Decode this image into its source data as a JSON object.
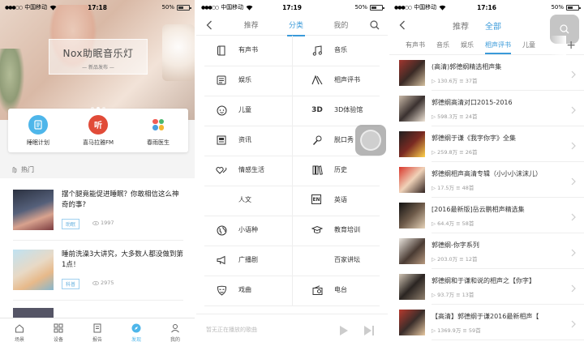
{
  "colors": {
    "accent": "#3a9ad9",
    "sleep_blue": "#4eb6ea",
    "xmly_red": "#e14b38"
  },
  "panel1": {
    "status": {
      "carrier": "中国移动",
      "time": "17:18",
      "battery": "50%"
    },
    "banner": {
      "title": "Nox助眠音乐灯",
      "subtitle": "— 新品发布 —"
    },
    "quick_links": [
      {
        "label": "睡眠计划",
        "icon": "sleep-plan-icon"
      },
      {
        "label": "喜马拉雅FM",
        "icon": "ximalaya-icon",
        "glyph": "听"
      },
      {
        "label": "春雨医生",
        "icon": "chunyu-icon"
      }
    ],
    "hot_label": "热门",
    "articles": [
      {
        "title": "摆个腿竟能促进睡眠？你敢相信这么神奇的事?",
        "tag": "助眠",
        "views": "1997"
      },
      {
        "title": "睡前洗澡3大讲究，大多数人都没做到第1点！",
        "tag": "科普",
        "views": "2975"
      }
    ],
    "tabs": [
      {
        "label": "场景",
        "icon": "home-icon"
      },
      {
        "label": "设备",
        "icon": "grid-icon"
      },
      {
        "label": "报告",
        "icon": "report-icon"
      },
      {
        "label": "发现",
        "icon": "discover-icon",
        "active": true
      },
      {
        "label": "我的",
        "icon": "user-icon"
      }
    ]
  },
  "panel2": {
    "status": {
      "carrier": "中国移动",
      "time": "17:19",
      "battery": "50%"
    },
    "tabs": [
      {
        "label": "推荐"
      },
      {
        "label": "分类",
        "active": true
      },
      {
        "label": "我的"
      }
    ],
    "categories": [
      {
        "label": "有声书",
        "icon": "book-icon"
      },
      {
        "label": "音乐",
        "icon": "music-note-icon"
      },
      {
        "label": "娱乐",
        "icon": "entertainment-icon"
      },
      {
        "label": "相声评书",
        "icon": "crosstalk-icon"
      },
      {
        "label": "儿童",
        "icon": "child-face-icon"
      },
      {
        "label": "3D体验馆",
        "icon": "3d-icon",
        "glyph": "3D"
      },
      {
        "label": "资讯",
        "icon": "news-icon"
      },
      {
        "label": "脱口秀",
        "icon": "microphone-icon"
      },
      {
        "label": "情感生活",
        "icon": "hearts-icon"
      },
      {
        "label": "历史",
        "icon": "books-icon"
      },
      {
        "label": "人文",
        "icon": ""
      },
      {
        "label": "英语",
        "icon": "english-icon",
        "glyph": "EN"
      },
      {
        "label": "小语种",
        "icon": "globe-icon"
      },
      {
        "label": "教育培训",
        "icon": "graduation-cap-icon"
      },
      {
        "label": "广播剧",
        "icon": "megaphone-icon"
      },
      {
        "label": "百家讲坛",
        "icon": ""
      },
      {
        "label": "戏曲",
        "icon": "opera-mask-icon"
      },
      {
        "label": "电台",
        "icon": "radio-icon"
      }
    ],
    "player_text": "暂无正在播放的歌曲"
  },
  "panel3": {
    "status": {
      "carrier": "中国移动",
      "time": "17:16",
      "battery": "50%"
    },
    "tabs": [
      {
        "label": "推荐"
      },
      {
        "label": "全部",
        "active": true
      }
    ],
    "subtabs": [
      {
        "label": "有声书"
      },
      {
        "label": "音乐"
      },
      {
        "label": "娱乐"
      },
      {
        "label": "相声评书",
        "active": true
      },
      {
        "label": "儿童"
      }
    ],
    "albums": [
      {
        "title": "(高清)郭德纲精选相声集",
        "plays": "130.6万",
        "episodes": "37首"
      },
      {
        "title": "郭德纲高清对口2015-2016",
        "plays": "598.3万",
        "episodes": "24首"
      },
      {
        "title": "郭德纲于谦《我字你字》全集",
        "plays": "259.8万",
        "episodes": "26首"
      },
      {
        "title": "郭德纲相声高清专辑（小小小沫沫儿）",
        "plays": "17.5万",
        "episodes": "48首"
      },
      {
        "title": "[2016最新版]岳云鹏相声精选集",
        "plays": "64.4万",
        "episodes": "58首"
      },
      {
        "title": "郭德纲-你字系列",
        "plays": "203.0万",
        "episodes": "12首"
      },
      {
        "title": "郭德纲和于谦和说的相声之【你字】",
        "plays": "93.7万",
        "episodes": "13首"
      },
      {
        "title": "【高清】郭德纲于谦2016最新相声【",
        "plays": "1369.9万",
        "episodes": "59首"
      }
    ]
  }
}
